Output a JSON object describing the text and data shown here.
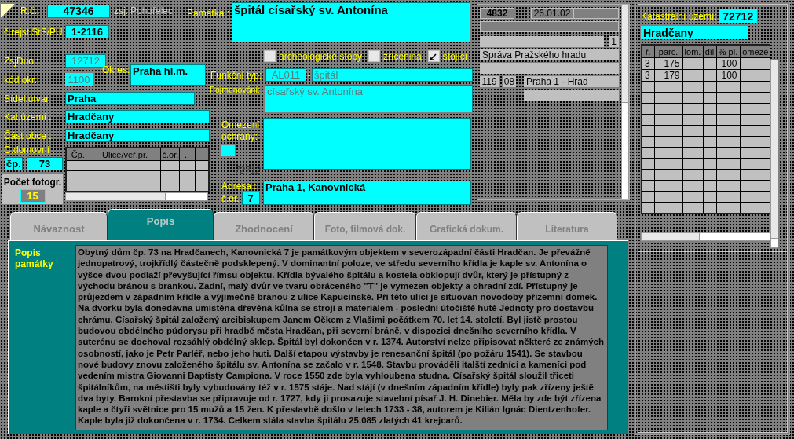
{
  "record": {
    "label": "R.č.:",
    "value": "47346"
  },
  "zsj": {
    "label": "zsj:",
    "value": "Pohořelec"
  },
  "register": {
    "label": "č.rejst.StS/PÚ:",
    "value": "1-2116"
  },
  "monument": {
    "label": "Památka :",
    "value": "špitál císařský sv. Antonína"
  },
  "zsj_duo": {
    "label": "ZsjDuo :",
    "value": "12712"
  },
  "district_code": {
    "label": "kód okr.:",
    "value": "1100"
  },
  "district": {
    "label": "Okres:",
    "value": "Praha hl.m."
  },
  "settlement": {
    "label": "Sídel.útvar :",
    "value": "Praha"
  },
  "cadastre": {
    "label": "Kat.území :",
    "value": "Hradčany"
  },
  "municipal_part": {
    "label": "Část obce :",
    "value": "Hradčany"
  },
  "house_number": {
    "label": "Č.domovní :",
    "type": "čp.",
    "value": "73"
  },
  "photo_count": {
    "label": "Počet fotogr.",
    "value": "15"
  },
  "street_table": {
    "columns": [
      "Čp.",
      "Ulice/veř.pr.",
      "č.or.",
      ".."
    ]
  },
  "checkboxes": [
    {
      "label": "archeologické stopy",
      "checked": false
    },
    {
      "label": "zřícenina",
      "checked": false
    },
    {
      "label": "stojící",
      "checked": true
    }
  ],
  "function_type": {
    "label": "Funkční typ:",
    "code": "AL011",
    "separator": "-",
    "value": "špitál"
  },
  "naming": {
    "label": "Pojmenování:",
    "value": "císařský sv. Antonína"
  },
  "protection": {
    "label": "Omezení ochrany:"
  },
  "faded_code": "72712",
  "address": {
    "label": "Adresa :",
    "number_label": "č.or.",
    "number": "7",
    "value": "Praha 1, Kanovnická"
  },
  "info_panel": {
    "id": "4832",
    "date": "26.01.02",
    "count": "1",
    "owner": "Správa Pražského hradu",
    "code_a": "119",
    "code_b": "08",
    "area": "Praha 1 - Hrad"
  },
  "cadastral": {
    "label": "Katastrální území:",
    "code": "72712",
    "name": "Hradčany",
    "columns": [
      "ř.",
      "parc.",
      "lom.",
      "díl",
      "% pl.",
      "omeze"
    ],
    "rows": [
      {
        "row": "3",
        "parcel": "175",
        "share": "100"
      },
      {
        "row": "3",
        "parcel": "179",
        "share": "100"
      }
    ]
  },
  "tabs": [
    {
      "label": "Návaznost",
      "selected": false
    },
    {
      "label": "Popis",
      "selected": true
    },
    {
      "label": "Zhodnocení",
      "selected": false
    },
    {
      "label": "Foto, filmová dok.",
      "selected": false
    },
    {
      "label": "Grafická dokum.",
      "selected": false
    },
    {
      "label": "Literatura",
      "selected": false
    }
  ],
  "description": {
    "label": "Popis památky",
    "text": "Obytný dům čp. 73 na Hradčanech, Kanovnická 7 je památkovým objektem v severozápadní části Hradčan. Je převážně jednopatrový, trojkřídlý částečně podsklepený. V dominantní poloze, ve středu severního křídla je kaple sv. Antonína o výšce dvou podlaží převyšující římsu objektu. Křídla bývalého špitálu a kostela obklopují dvůr, který je přístupný z východu bránou s brankou. Zadní, malý dvůr ve tvaru obráceného \"T\" je vymezen objekty a ohradní zdí. Přístupný je průjezdem v západním křídle a výjimečně bránou z ulice Kapucínské. Při této ulici je situován novodobý přízemní domek. Na dvorku byla donedávna umístěna dřevěná kůlna se stroji a materiálem - poslední útočiště hutě Jednoty pro dostavbu chrámu. Císařský špitál založený arcibiskupem Janem Očkem z Vlašimi počátkem 70. let 14. století. Byl jistě prostou budovou obdélného půdorysu při hradbě města Hradčan, při severní bráně, v dispozici dnešního severního křídla. V suterénu se dochoval rozsáhlý obdélný sklep. Špitál byl dokončen v r. 1374. Autorství nelze připisovat některé ze známých osobností, jako je Petr Parléř, nebo jeho huti. Další etapou výstavby je renesanční špitál (po požáru 1541). Se stavbou nové budovy znovu založeného špitálu sv. Antonína se začalo v r. 1548. Stavbu prováděli italští zedníci a kameníci pod vedením mistra Giovanni Baptisty Campiona. V roce 1550 zde byla vyhloubena studna. Císařský špitál sloužil třiceti špitálníkům, na městišti byly vybudovány též v r. 1575 stáje. Nad stájí (v dnešním západním křídle) byly pak zřízeny ještě dva byty. Barokní přestavba se připravuje od r. 1727, kdy ji prosazuje stavební písař J. H. Dinebier. Měla by zde být zřízena kaple a čtyři světnice pro 15 mužů a 15 žen. K přestavbě došlo v letech 1733 - 38, autorem je Kilián Ignác Dientzenhofer. Kaple byla již dokončena v r. 1734. Celkem stála stavba špitálu 25.085 zlatých 41 krejcarů."
  }
}
